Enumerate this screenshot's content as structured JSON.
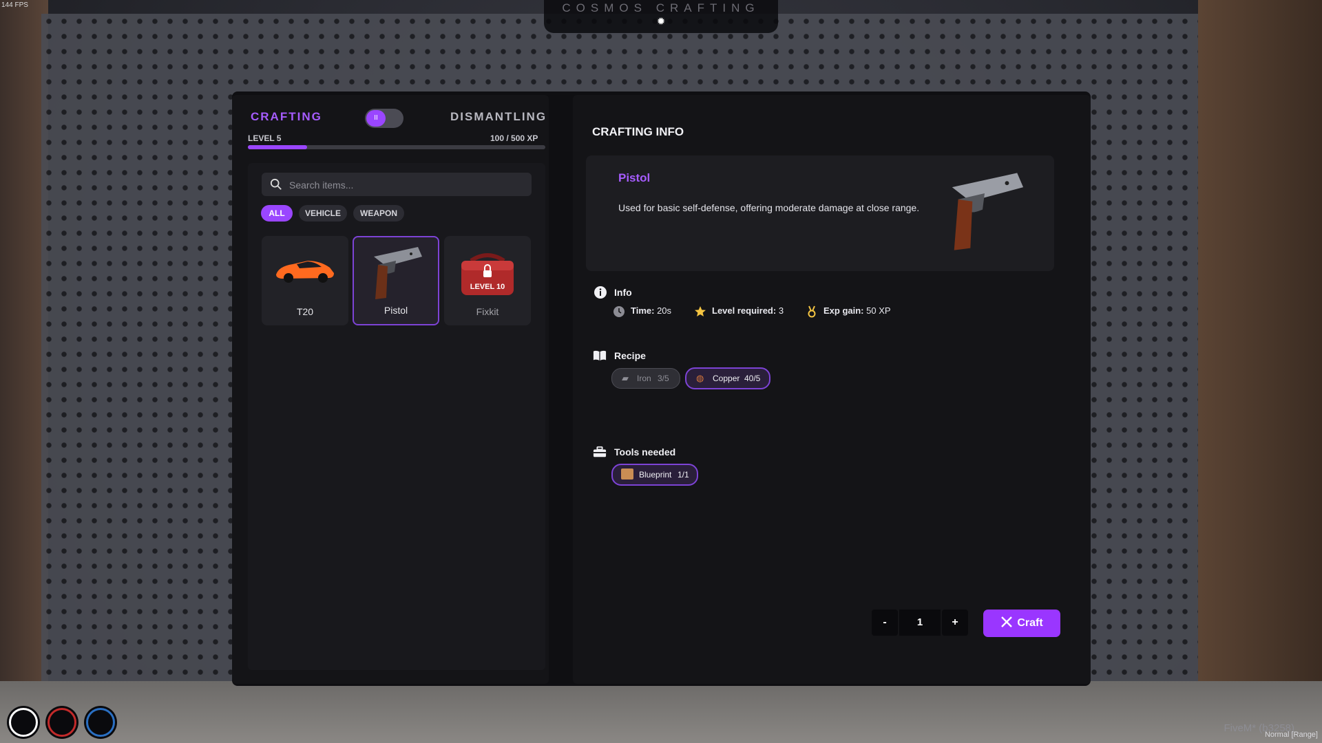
{
  "overlay": {
    "fps": "144 FPS",
    "title": "COSMOS CRAFTING"
  },
  "tabs": {
    "crafting": "CRAFTING",
    "dismantling": "DISMANTLING"
  },
  "progress": {
    "level": "LEVEL 5",
    "xp": "100 / 500 XP",
    "fraction": 0.2
  },
  "search": {
    "placeholder": "Search items..."
  },
  "filters": [
    "ALL",
    "VEHICLE",
    "WEAPON"
  ],
  "items": [
    {
      "name": "T20"
    },
    {
      "name": "Pistol"
    },
    {
      "name": "Fixkit",
      "lock_label": "LEVEL 10"
    }
  ],
  "info": {
    "heading": "CRAFTING INFO",
    "item_name": "Pistol",
    "description": "Used for basic self-defense, offering moderate damage at close range.",
    "info_label": "Info",
    "time_label": "Time:",
    "time_value": "20s",
    "level_label": "Level required:",
    "level_value": "3",
    "exp_label": "Exp gain:",
    "exp_value": "50 XP",
    "recipe_label": "Recipe",
    "recipe": [
      {
        "name": "Iron",
        "qty": "3/5"
      },
      {
        "name": "Copper",
        "qty": "40/5"
      }
    ],
    "tools_label": "Tools needed",
    "tools": [
      {
        "name": "Blueprint",
        "qty": "1/1"
      }
    ]
  },
  "controls": {
    "minus": "-",
    "quantity": "1",
    "plus": "+",
    "craft": "Craft"
  },
  "footer": {
    "client": "FiveM* (b3258)",
    "mode": "Normal [Range]"
  },
  "colors": {
    "accent": "#9a46ff",
    "background": "#141417"
  }
}
